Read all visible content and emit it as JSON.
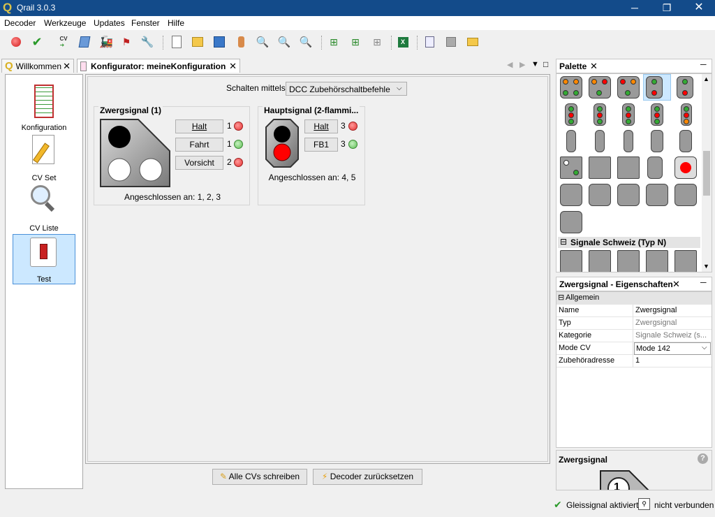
{
  "app": {
    "title": "Qrail 3.0.3"
  },
  "menu": [
    "Decoder",
    "Werkzeuge",
    "Updates",
    "Fenster",
    "Hilfe"
  ],
  "tabs": {
    "welcome": "Willkommen",
    "configurator": "Konfigurator: meineKonfiguration"
  },
  "nav": [
    {
      "label": "Konfiguration",
      "icon": "decoder-icon"
    },
    {
      "label": "CV Set",
      "icon": "pencil-icon"
    },
    {
      "label": "CV Liste",
      "icon": "magnifier-icon"
    },
    {
      "label": "Test",
      "icon": "switch-icon",
      "selected": true
    }
  ],
  "editor": {
    "switch_label": "Schalten mittels:",
    "switch_value": "DCC Zubehörschaltbefehle",
    "signals": [
      {
        "title": "Zwergsignal (1)",
        "aspects": [
          {
            "label": "Halt",
            "num": "1",
            "led": "red"
          },
          {
            "label": "Fahrt",
            "num": "1",
            "led": "green"
          },
          {
            "label": "Vorsicht",
            "num": "2",
            "led": "red"
          }
        ],
        "connected": "Angeschlossen an: 1, 2, 3"
      },
      {
        "title": "Hauptsignal (2-flammi...",
        "aspects": [
          {
            "label": "Halt",
            "num": "3",
            "led": "red"
          },
          {
            "label": "FB1",
            "num": "3",
            "led": "green"
          }
        ],
        "connected": "Angeschlossen an: 4, 5"
      }
    ]
  },
  "bottom_buttons": {
    "write_all": "Alle CVs schreiben",
    "reset": "Decoder zurücksetzen"
  },
  "palette": {
    "title": "Palette",
    "section": "Signale Schweiz (Typ N)"
  },
  "properties": {
    "title": "Zwergsignal - Eigenschaften",
    "group": "Allgemein",
    "rows": [
      {
        "key": "Name",
        "value": "Zwergsignal"
      },
      {
        "key": "Typ",
        "value": "Zwergsignal"
      },
      {
        "key": "Kategorie",
        "value": "Signale Schweiz (s..."
      },
      {
        "key": "Mode CV",
        "value": "Mode 142"
      },
      {
        "key": "Zubehöradresse",
        "value": "1"
      }
    ]
  },
  "preview": {
    "title": "Zwergsignal",
    "number": "1"
  },
  "status": {
    "track": "Gleissignal aktiviert",
    "connection": "nicht verbunden"
  }
}
